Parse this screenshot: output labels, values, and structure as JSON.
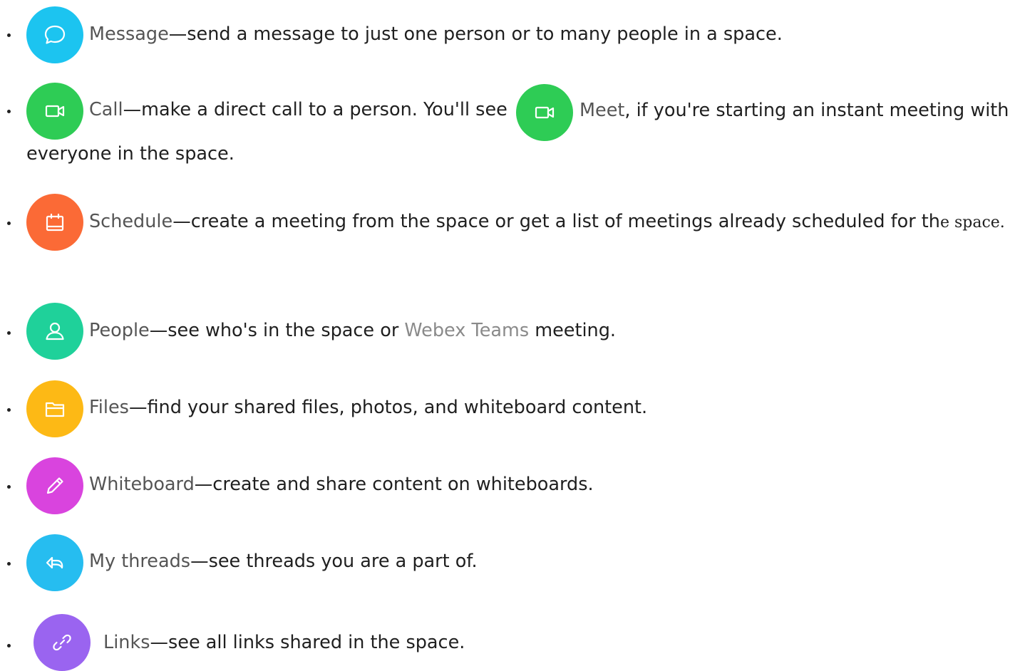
{
  "items": [
    {
      "term": "Message",
      "desc": "—send a message to just one person or to many people in a space.",
      "icon": "chat-bubble-icon",
      "color": "#1cc4f0"
    },
    {
      "term": "Call",
      "desc_a": "—make a direct call to a person. You'll see ",
      "term2": "Meet",
      "desc_b": ", if you're starting an instant meeting with",
      "desc_c": "everyone in the space.",
      "icon": "video-camera-icon",
      "color": "#2ecc55"
    },
    {
      "term": "Schedule",
      "desc": "—create a meeting from the space or get a list of meetings already scheduled for th",
      "desc_serif": "e space.",
      "icon": "calendar-icon",
      "color": "#fb6a36"
    },
    {
      "term": "People",
      "desc_a": "—see who's in the space or ",
      "link": "Webex Teams",
      "desc_b": " meeting.",
      "icon": "person-icon",
      "color": "#1fd19a"
    },
    {
      "term": "Files",
      "desc": "—find your shared files, photos, and whiteboard content.",
      "icon": "folder-icon",
      "color": "#fdb915"
    },
    {
      "term": "Whiteboard",
      "desc": "—create and share content on whiteboards.",
      "icon": "pencil-icon",
      "color": "#d944de"
    },
    {
      "term": "My threads",
      "desc": "—see threads you are a part of.",
      "icon": "reply-arrow-icon",
      "color": "#26bdf0"
    },
    {
      "term": "Links",
      "desc": "—see all links shared in the space.",
      "icon": "link-icon",
      "color": "#9a64f0"
    }
  ]
}
